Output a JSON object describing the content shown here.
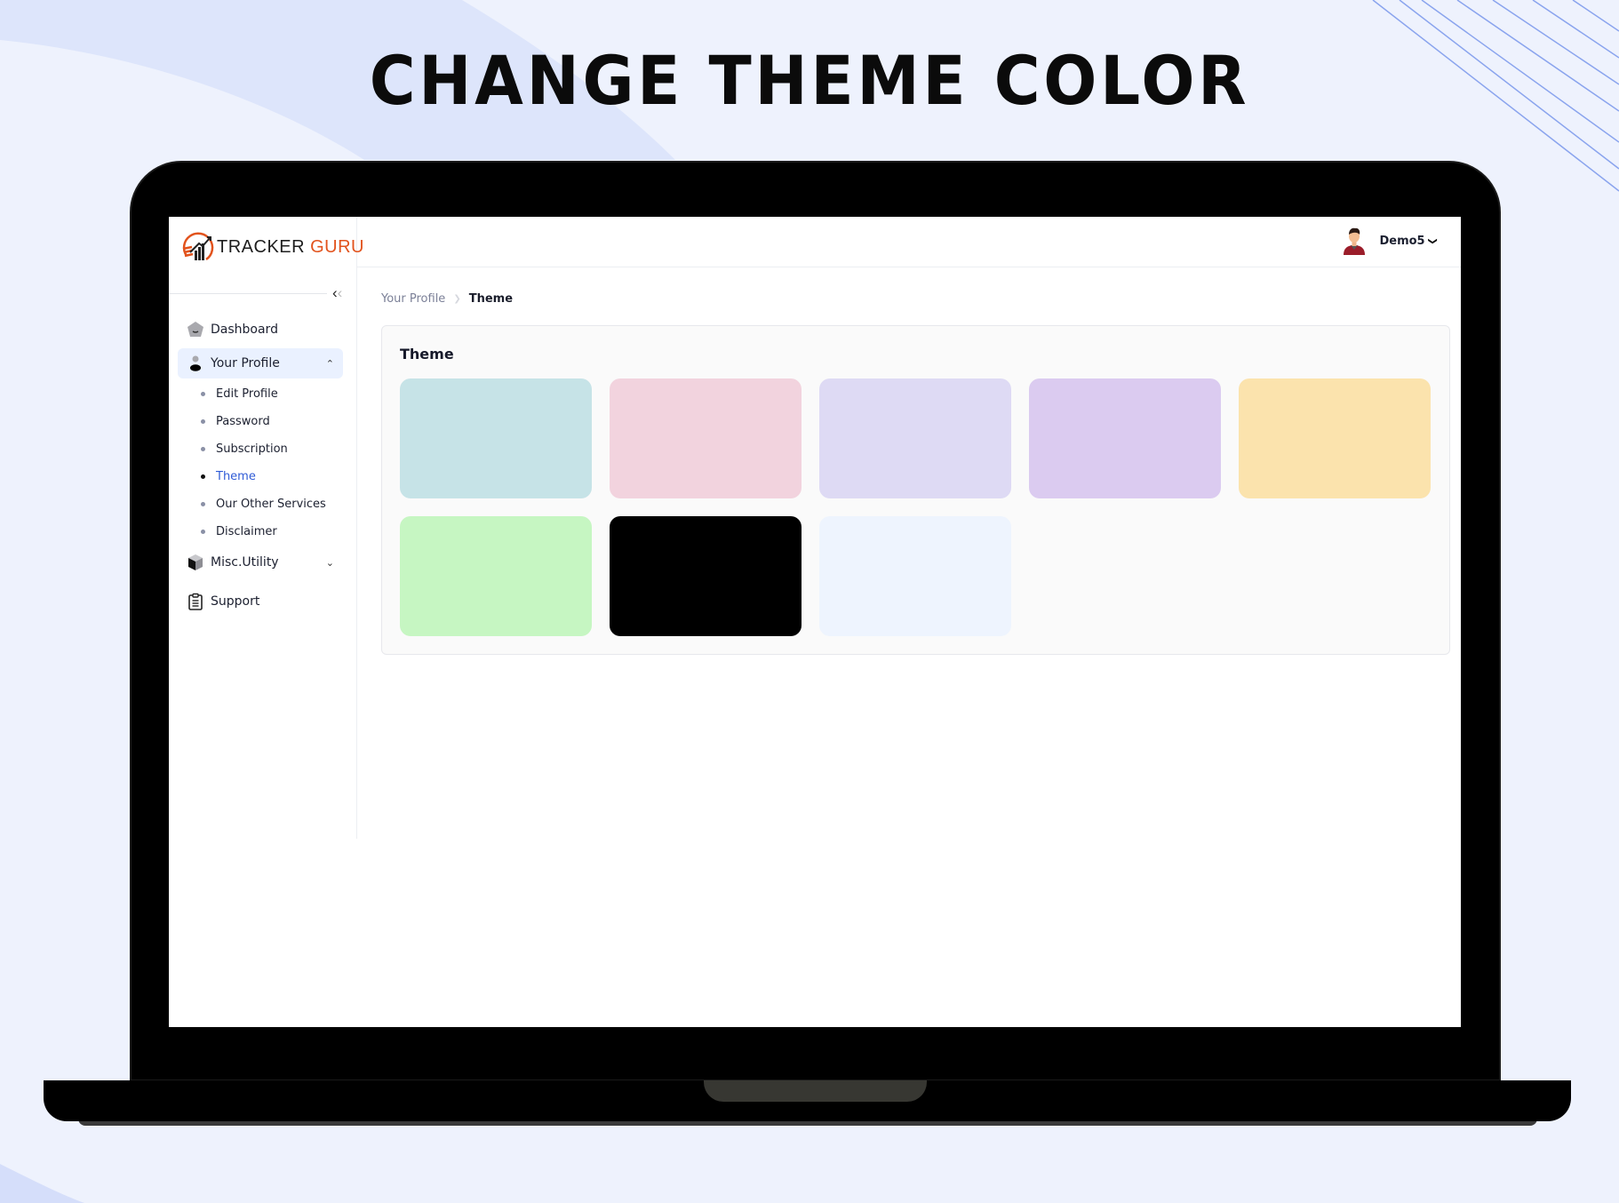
{
  "headline": "CHANGE THEME COLOR",
  "app": {
    "logo": {
      "part1": "TRACKER",
      "part2": "GURU",
      "brand_color": "#e2531d"
    },
    "collapse_icon": "double-chevron-left-icon",
    "sidebar": {
      "items": [
        {
          "label": "Dashboard",
          "icon": "dashboard-icon"
        },
        {
          "label": "Your Profile",
          "icon": "user-icon",
          "expanded": true,
          "active": true,
          "children": [
            {
              "label": "Edit Profile"
            },
            {
              "label": "Password"
            },
            {
              "label": "Subscription"
            },
            {
              "label": "Theme",
              "active": true
            },
            {
              "label": "Our Other Services"
            },
            {
              "label": "Disclaimer"
            }
          ]
        },
        {
          "label": "Misc.Utility",
          "icon": "cube-icon",
          "expanded": false
        },
        {
          "label": "Support",
          "icon": "clipboard-icon"
        }
      ]
    },
    "header": {
      "username": "Demo5"
    },
    "breadcrumb": {
      "parent": "Your Profile",
      "current": "Theme"
    },
    "theme_card": {
      "title": "Theme",
      "swatches": [
        {
          "name": "teal",
          "color": "#c6e3e7"
        },
        {
          "name": "pink",
          "color": "#f2d3de"
        },
        {
          "name": "lavender",
          "color": "#dedaf4"
        },
        {
          "name": "purple",
          "color": "#dbcbf0"
        },
        {
          "name": "yellow",
          "color": "#fbe3ad"
        },
        {
          "name": "green",
          "color": "#c6f6c2"
        },
        {
          "name": "black",
          "color": "#000000"
        },
        {
          "name": "light-blue",
          "color": "#eef4fe"
        }
      ]
    },
    "accent_color": "#2f5bd6"
  }
}
